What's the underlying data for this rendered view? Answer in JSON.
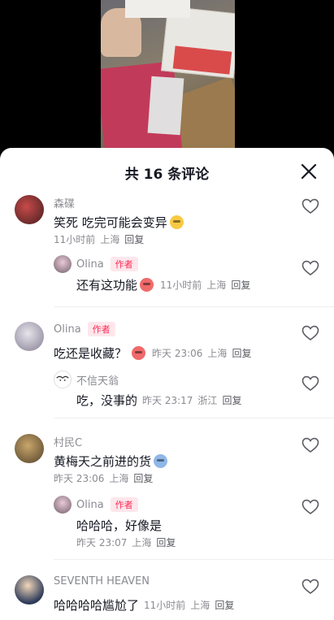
{
  "header": {
    "title": "共 16 条评论"
  },
  "comments": [
    {
      "user": "森碟",
      "text": "笑死 吃完可能会变异",
      "time": "11小时前",
      "location": "上海",
      "reply": "回复",
      "replies": [
        {
          "user": "Olina",
          "tag": "作者",
          "text": "还有这功能",
          "time": "11小时前",
          "location": "上海",
          "reply": "回复"
        }
      ]
    },
    {
      "user": "Olina",
      "tag": "作者",
      "text": "吃还是收藏？",
      "time": "昨天 23:06",
      "location": "上海",
      "reply": "回复",
      "replies": [
        {
          "user": "不信天翁",
          "text": "吃，没事的",
          "time": "昨天 23:17",
          "location": "浙江",
          "reply": "回复"
        }
      ]
    },
    {
      "user": "村民C",
      "text": "黄梅天之前进的货",
      "time": "昨天 23:06",
      "location": "上海",
      "reply": "回复",
      "replies": [
        {
          "user": "Olina",
          "tag": "作者",
          "text": "哈哈哈，好像是",
          "time": "昨天 23:07",
          "location": "上海",
          "reply": "回复"
        }
      ]
    },
    {
      "user": "SEVENTH HEAVEN",
      "text": "哈哈哈哈尴尬了",
      "time": "11小时前",
      "location": "上海",
      "reply": "回复",
      "replies": []
    }
  ],
  "icons": {
    "close": "close-icon",
    "like": "heart-outline-icon"
  },
  "colors": {
    "author_tag": "#fe2c55",
    "author_tag_bg": "#fde7ec",
    "meta": "#8a8b91"
  }
}
